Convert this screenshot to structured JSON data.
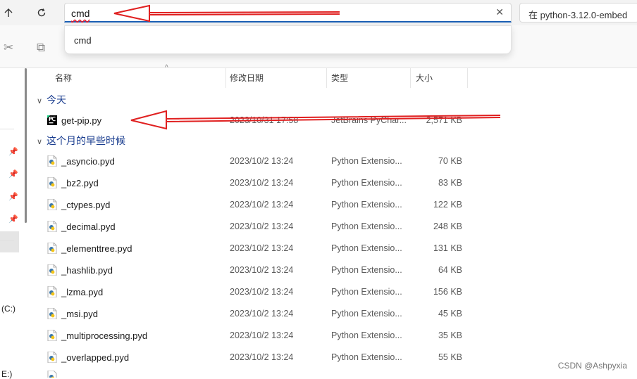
{
  "address_bar": {
    "value": "cmd",
    "clear_glyph": "✕"
  },
  "search_box": {
    "text": "在 python-3.12.0-embed"
  },
  "autocomplete": {
    "item": "cmd"
  },
  "nav": {
    "drive_c": "(C:)",
    "drive_e": "E:)"
  },
  "columns": {
    "name": "名称",
    "date": "修改日期",
    "type": "类型",
    "size": "大小"
  },
  "groups": {
    "today": "今天",
    "this_month": "这个月的早些时候"
  },
  "today_files": [
    {
      "name": "get-pip.py",
      "date": "2023/10/31 17:58",
      "type": "JetBrains PyChar...",
      "size": "2,571 KB",
      "icon": "pycharm-icon"
    }
  ],
  "month_files": [
    {
      "name": "_asyncio.pyd",
      "date": "2023/10/2 13:24",
      "type": "Python Extensio...",
      "size": "70 KB",
      "icon": "python-file-icon"
    },
    {
      "name": "_bz2.pyd",
      "date": "2023/10/2 13:24",
      "type": "Python Extensio...",
      "size": "83 KB",
      "icon": "python-file-icon"
    },
    {
      "name": "_ctypes.pyd",
      "date": "2023/10/2 13:24",
      "type": "Python Extensio...",
      "size": "122 KB",
      "icon": "python-file-icon"
    },
    {
      "name": "_decimal.pyd",
      "date": "2023/10/2 13:24",
      "type": "Python Extensio...",
      "size": "248 KB",
      "icon": "python-file-icon"
    },
    {
      "name": "_elementtree.pyd",
      "date": "2023/10/2 13:24",
      "type": "Python Extensio...",
      "size": "131 KB",
      "icon": "python-file-icon"
    },
    {
      "name": "_hashlib.pyd",
      "date": "2023/10/2 13:24",
      "type": "Python Extensio...",
      "size": "64 KB",
      "icon": "python-file-icon"
    },
    {
      "name": "_lzma.pyd",
      "date": "2023/10/2 13:24",
      "type": "Python Extensio...",
      "size": "156 KB",
      "icon": "python-file-icon"
    },
    {
      "name": "_msi.pyd",
      "date": "2023/10/2 13:24",
      "type": "Python Extensio...",
      "size": "45 KB",
      "icon": "python-file-icon"
    },
    {
      "name": "_multiprocessing.pyd",
      "date": "2023/10/2 13:24",
      "type": "Python Extensio...",
      "size": "35 KB",
      "icon": "python-file-icon"
    },
    {
      "name": "_overlapped.pyd",
      "date": "2023/10/2 13:24",
      "type": "Python Extensio...",
      "size": "55 KB",
      "icon": "python-file-icon"
    }
  ],
  "watermark": "CSDN @Ashpyxia",
  "colors": {
    "accent": "#1a5fb4",
    "annotation": "#e02020",
    "group_text": "#1a3d8f"
  }
}
